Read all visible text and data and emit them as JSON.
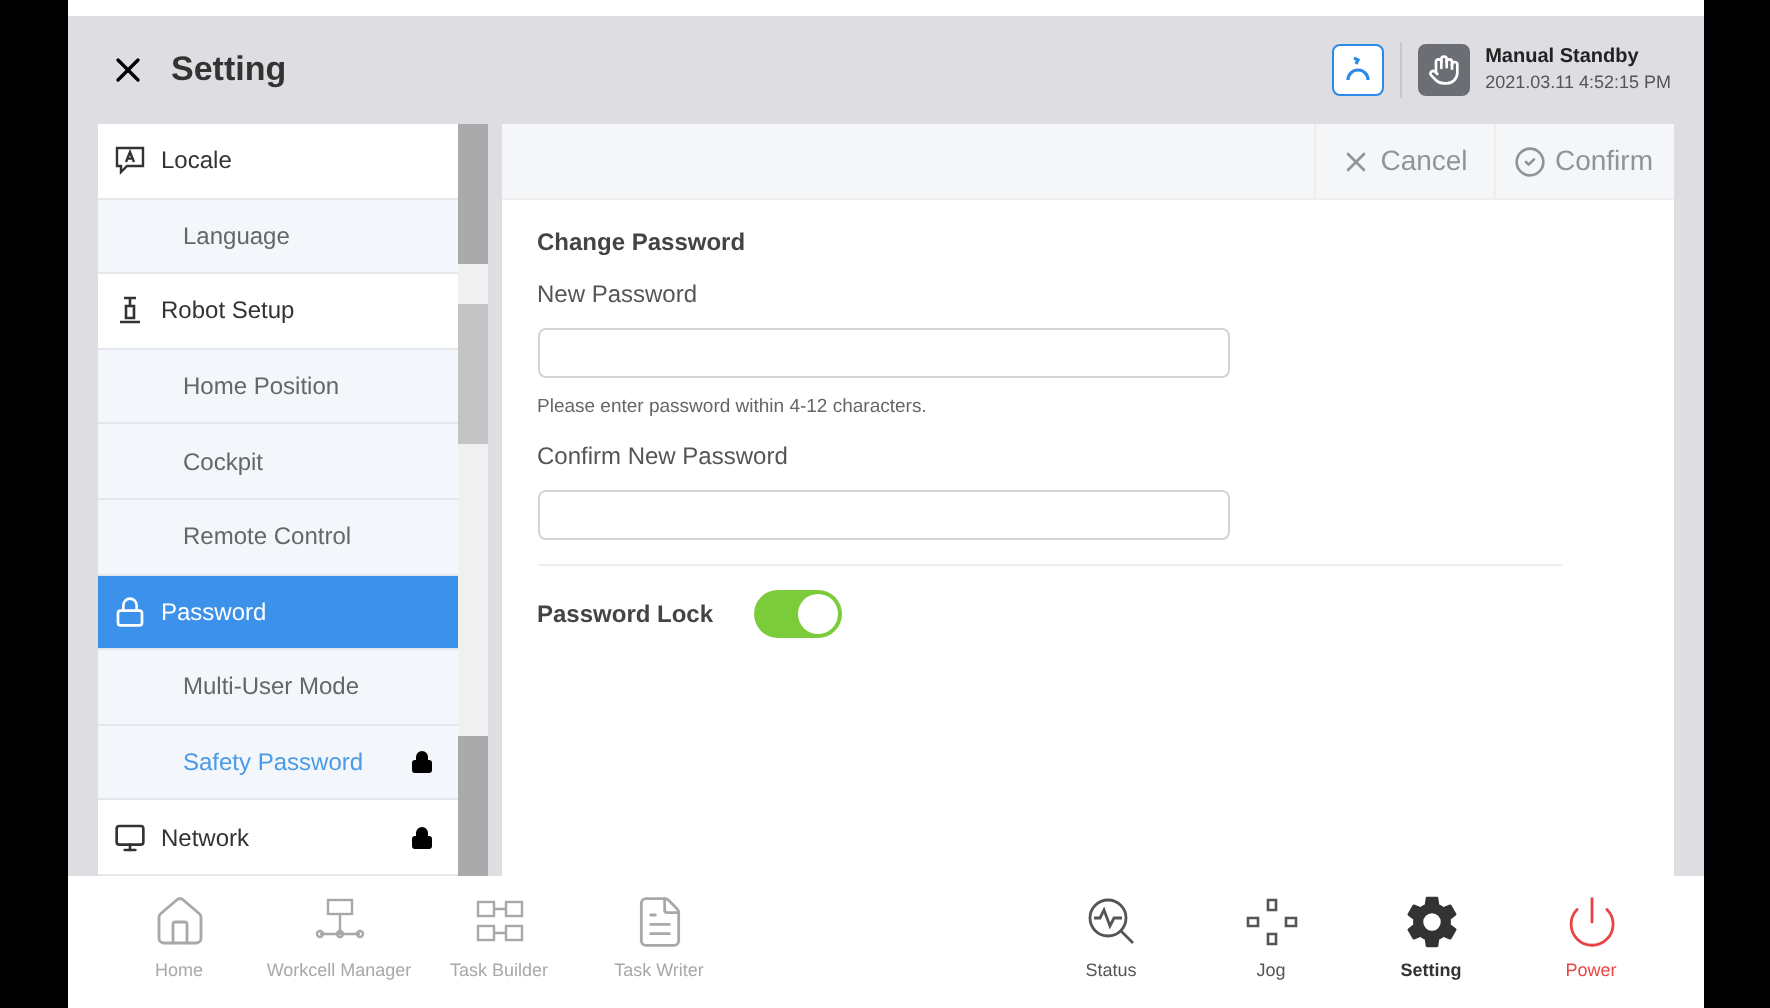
{
  "header": {
    "title": "Setting",
    "status": "Manual Standby",
    "datetime": "2021.03.11 4:52:15 PM"
  },
  "sidebar": {
    "items": [
      {
        "label": "Locale",
        "kind": "section",
        "selected": false,
        "locked": false,
        "highlighted": false
      },
      {
        "label": "Language",
        "kind": "sub",
        "selected": false,
        "locked": false,
        "highlighted": false
      },
      {
        "label": "Robot Setup",
        "kind": "section",
        "selected": false,
        "locked": false,
        "highlighted": false
      },
      {
        "label": "Home Position",
        "kind": "sub",
        "selected": false,
        "locked": false,
        "highlighted": false
      },
      {
        "label": "Cockpit",
        "kind": "sub",
        "selected": false,
        "locked": false,
        "highlighted": false
      },
      {
        "label": "Remote Control",
        "kind": "sub",
        "selected": false,
        "locked": false,
        "highlighted": false
      },
      {
        "label": "Password",
        "kind": "section",
        "selected": true,
        "locked": false,
        "highlighted": false
      },
      {
        "label": "Multi-User Mode",
        "kind": "sub",
        "selected": false,
        "locked": false,
        "highlighted": false
      },
      {
        "label": "Safety Password",
        "kind": "sub",
        "selected": false,
        "locked": true,
        "highlighted": true
      },
      {
        "label": "Network",
        "kind": "section",
        "selected": false,
        "locked": true,
        "highlighted": false
      }
    ]
  },
  "toolbar": [
    {
      "label": "Cancel",
      "kind": "cancel",
      "disabled": true
    },
    {
      "label": "Confirm",
      "kind": "confirm",
      "disabled": true
    }
  ],
  "form": {
    "title": "Change Password",
    "fields": [
      {
        "label": "New Password",
        "hint": "Please enter password within 4-12 characters."
      },
      {
        "label": "Confirm New Password"
      }
    ],
    "lock": {
      "label": "Password Lock",
      "on": true
    }
  },
  "nav": [
    {
      "label": "Home",
      "kind": "plain",
      "disabled": true,
      "selected": false
    },
    {
      "label": "Workcell Manager",
      "kind": "plain",
      "disabled": true,
      "selected": false
    },
    {
      "label": "Task Builder",
      "kind": "plain",
      "disabled": true,
      "selected": false
    },
    {
      "label": "Task Writer",
      "kind": "plain",
      "disabled": true,
      "selected": false
    },
    {
      "label": "Status",
      "kind": "plain",
      "disabled": false,
      "selected": false
    },
    {
      "label": "Jog",
      "kind": "plain",
      "disabled": false,
      "selected": false
    },
    {
      "label": "Setting",
      "kind": "plain",
      "disabled": false,
      "selected": true
    },
    {
      "label": "Power",
      "kind": "power",
      "disabled": false,
      "selected": false
    }
  ]
}
